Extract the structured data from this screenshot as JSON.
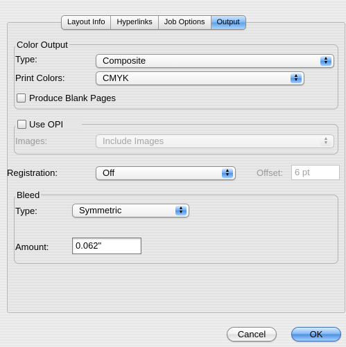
{
  "tabs": [
    {
      "label": "Layout Info",
      "active": false
    },
    {
      "label": "Hyperlinks",
      "active": false
    },
    {
      "label": "Job Options",
      "active": false
    },
    {
      "label": "Output",
      "active": true
    }
  ],
  "color_output": {
    "legend": "Color Output",
    "type_label": "Type:",
    "type_value": "Composite",
    "print_colors_label": "Print Colors:",
    "print_colors_value": "CMYK",
    "blank_pages_label": "Produce Blank Pages",
    "blank_pages_checked": false
  },
  "opi": {
    "legend": "Use OPI",
    "checked": false,
    "images_label": "Images:",
    "images_value": "Include Images"
  },
  "registration": {
    "label": "Registration:",
    "value": "Off",
    "offset_label": "Offset:",
    "offset_value": "6 pt"
  },
  "bleed": {
    "legend": "Bleed",
    "type_label": "Type:",
    "type_value": "Symmetric",
    "amount_label": "Amount:",
    "amount_value": "0.062\""
  },
  "buttons": {
    "cancel": "Cancel",
    "ok": "OK"
  },
  "colors": {
    "accent": "#5a9ee9"
  }
}
